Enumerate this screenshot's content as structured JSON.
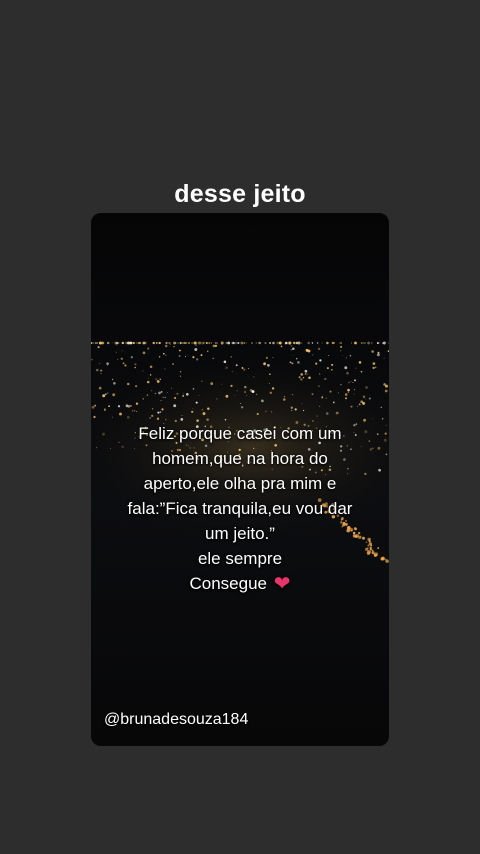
{
  "caption": "desse jeito",
  "story": {
    "lines": [
      "Feliz porque casei com um",
      "homem,que na hora do",
      "aperto,ele olha pra mim e",
      "fala:”Fica tranquila,eu vou dar",
      "um jeito.”",
      "ele sempre",
      "Consegue"
    ],
    "emoji": "❤",
    "handle": "@brunadesouza184"
  },
  "colors": {
    "background": "#2e2d2e",
    "card": "#0b0b0c",
    "city_lights": "#f2c56b",
    "heart": "#e8336b"
  },
  "icons": [
    "heart-icon"
  ]
}
